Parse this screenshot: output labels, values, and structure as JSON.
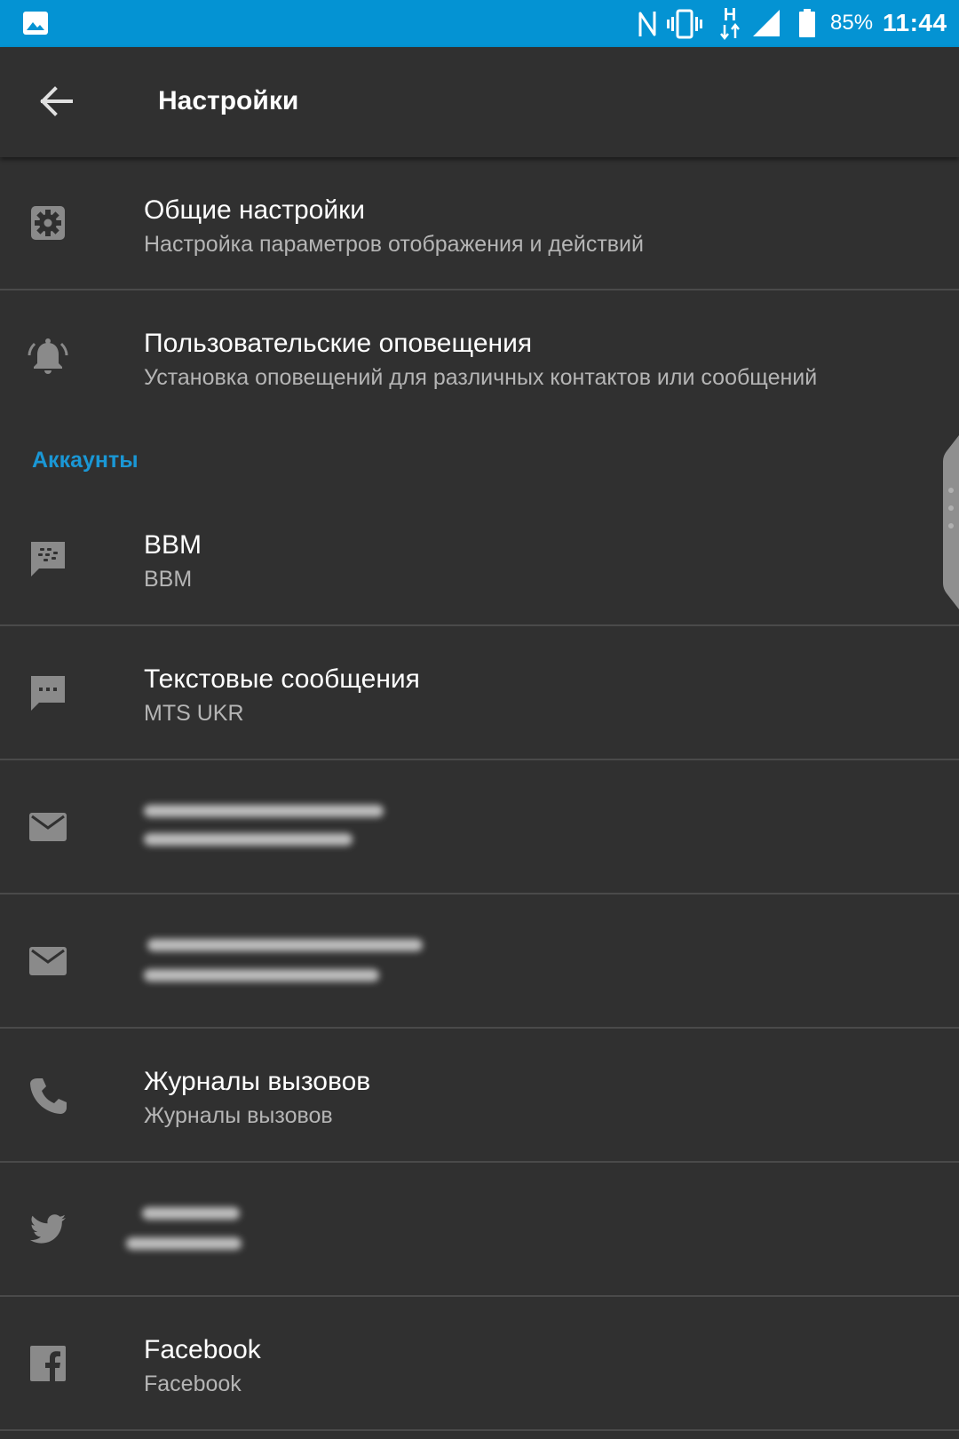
{
  "status_bar": {
    "battery_percent": "85%",
    "time": "11:44",
    "network_type": "H",
    "accent_color": "#0493d3",
    "icons": [
      "gallery-icon",
      "nfc-icon",
      "vibrate-icon",
      "network-h-icon",
      "signal-icon",
      "battery-icon"
    ]
  },
  "app_bar": {
    "title": "Настройки",
    "back_icon": "arrow-back-icon"
  },
  "settings": [
    {
      "icon": "gear-icon",
      "title": "Общие настройки",
      "subtitle": "Настройка параметров отображения и действий"
    },
    {
      "icon": "bell-ringing-icon",
      "title": "Пользовательские оповещения",
      "subtitle": "Установка оповещений для различных контактов или сообщений"
    }
  ],
  "accounts_section": {
    "header": "Аккаунты",
    "header_color": "#1a97d5"
  },
  "accounts": [
    {
      "icon": "bbm-icon",
      "title": "BBM",
      "subtitle": "BBM"
    },
    {
      "icon": "sms-icon",
      "title": "Текстовые сообщения",
      "subtitle": "MTS UKR"
    },
    {
      "icon": "email-icon",
      "redacted": true
    },
    {
      "icon": "email-icon",
      "redacted": true
    },
    {
      "icon": "phone-icon",
      "title": "Журналы вызовов",
      "subtitle": "Журналы вызовов"
    },
    {
      "icon": "twitter-icon",
      "redacted": true
    },
    {
      "icon": "facebook-icon",
      "title": "Facebook",
      "subtitle": "Facebook"
    }
  ]
}
